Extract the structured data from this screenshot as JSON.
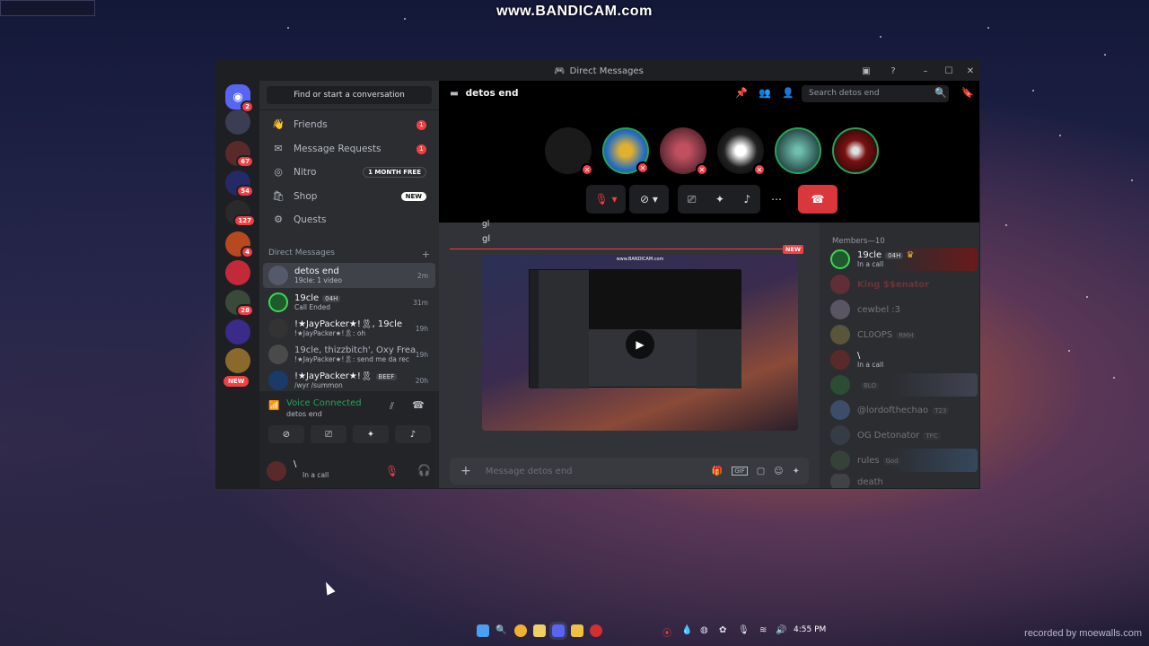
{
  "watermark": "www.BANDICAM.com",
  "recorded_by": "recorded by moewalls.com",
  "window": {
    "title": "Direct Messages"
  },
  "servers": [
    {
      "badge": "2"
    },
    {
      "badge": ""
    },
    {
      "badge": "67"
    },
    {
      "badge": "54"
    },
    {
      "badge": "127"
    },
    {
      "badge": "4"
    },
    {
      "badge": ""
    },
    {
      "badge": "28"
    },
    {
      "badge": ""
    },
    {
      "badge": ""
    }
  ],
  "servers_new_label": "NEW",
  "sidebar": {
    "find_label": "Find or start a conversation",
    "nav": [
      {
        "label": "Friends",
        "badge": "1"
      },
      {
        "label": "Message Requests",
        "badge": "1"
      },
      {
        "label": "Nitro",
        "pill": "1 MONTH FREE"
      },
      {
        "label": "Shop",
        "pill": "NEW"
      },
      {
        "label": "Quests"
      }
    ],
    "dm_header": "Direct Messages",
    "dm_add": "+",
    "dms": [
      {
        "name": "detos end",
        "sub": "19cle: 1 video",
        "time": "2m"
      },
      {
        "name": "19cle",
        "tag": "04H",
        "sub": "Call Ended",
        "time": "31m"
      },
      {
        "name": "!★JayPacker★!🎗, 19cle",
        "sub": "!★JayPacker★!🎗: oh",
        "time": "19h"
      },
      {
        "name": "19cle, thizzbitch', Oxy Frea...",
        "sub": "!★JayPacker★!🎗: send me da rec",
        "time": "19h"
      },
      {
        "name": "!★JayPacker★!🎗",
        "tag": "BEEF",
        "sub": "/wyr /summon",
        "time": "20h"
      }
    ]
  },
  "voice": {
    "title": "Voice Connected",
    "channel": "detos end"
  },
  "user": {
    "name": "\\",
    "status": "In a call"
  },
  "channel": {
    "name": "detos end",
    "search_placeholder": "Search detos end"
  },
  "chat": {
    "lines": [
      "gl",
      "gl"
    ],
    "new_label": "NEW",
    "video_watermark": "www.BANDICAM.com",
    "input_placeholder": "Message detos end"
  },
  "members": {
    "header": "Members—10",
    "list": [
      {
        "name": "19cle",
        "tag": "04H",
        "sub": "In a call"
      },
      {
        "name": "King $$enator",
        "sub": ""
      },
      {
        "name": "cewbel :3",
        "sub": ""
      },
      {
        "name": "CL0OPS",
        "tag": "RMH",
        "sub": ""
      },
      {
        "name": "\\",
        "sub": "In a call"
      },
      {
        "name": "",
        "tag": "BLO",
        "sub": ""
      },
      {
        "name": "@lordofthechao",
        "tag": "T23",
        "sub": ""
      },
      {
        "name": "OG Detonator",
        "tag": "TFC",
        "sub": ""
      },
      {
        "name": "rules",
        "tag": "God",
        "sub": ""
      },
      {
        "name": "death",
        "sub": ""
      }
    ]
  },
  "taskbar": {
    "time": "4:55 PM"
  },
  "colors": {
    "accent": "#5865f2",
    "danger": "#f23f43",
    "online": "#23a55a"
  }
}
